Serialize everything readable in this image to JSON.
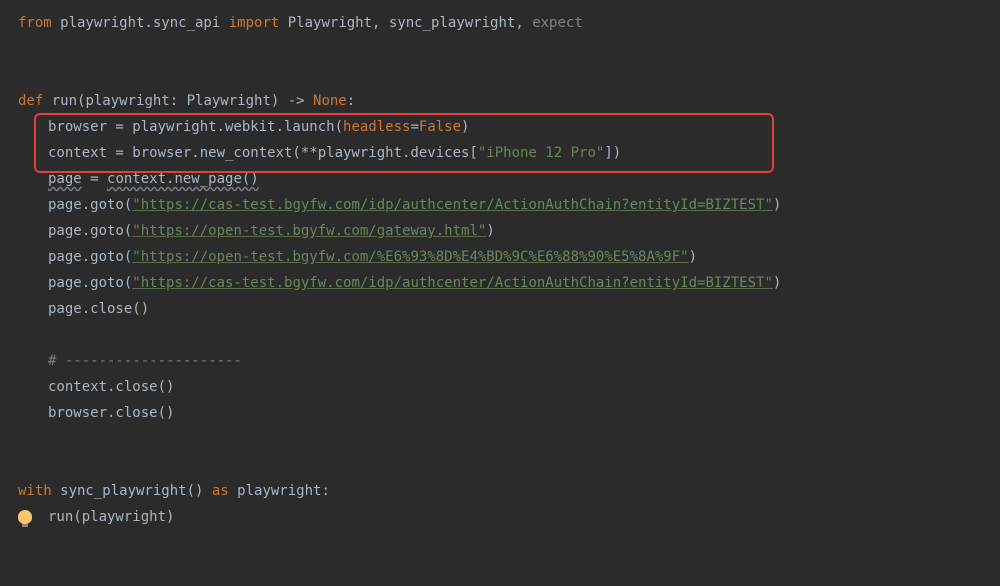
{
  "code": {
    "l1_from": "from",
    "l1_module": " playwright.sync_api ",
    "l1_import": "import",
    "l1_names": " Playwright, sync_playwright, ",
    "l1_expect": "expect",
    "l3_def": "def",
    "l3_sig1": " run(playwright: Playwright) -> ",
    "l3_none": "None",
    "l3_sig2": ":",
    "l4": "browser = playwright.webkit.launch(",
    "l4_param": "headless",
    "l4_eq": "=",
    "l4_false": "False",
    "l4_close": ")",
    "l5": "context = browser.new_context(**playwright.devices[",
    "l5_str": "\"iPhone 12 Pro\"",
    "l5_close": "])",
    "l6_a": "page",
    "l6_b": " = ",
    "l6_c": "context.new_page()",
    "l7": "page.goto(",
    "l7_url": "\"https://cas-test.bgyfw.com/idp/authcenter/ActionAuthChain?entityId=BIZTEST\"",
    "l7_close": ")",
    "l8": "page.goto(",
    "l8_url": "\"https://open-test.bgyfw.com/gateway.html\"",
    "l8_close": ")",
    "l9": "page.goto(",
    "l9_url": "\"https://open-test.bgyfw.com/%E6%93%8D%E4%BD%9C%E6%88%90%E5%8A%9F\"",
    "l9_close": ")",
    "l10": "page.goto(",
    "l10_url": "\"https://cas-test.bgyfw.com/idp/authcenter/ActionAuthChain?entityId=BIZTEST\"",
    "l10_close": ")",
    "l11": "page.close()",
    "l13": "# ---------------------",
    "l14": "context.close()",
    "l15": "browser.close()",
    "l17_with": "with",
    "l17_body": " sync_playwright() ",
    "l17_as": "as",
    "l17_var": " playwright:",
    "l18": "run(playwright)"
  }
}
